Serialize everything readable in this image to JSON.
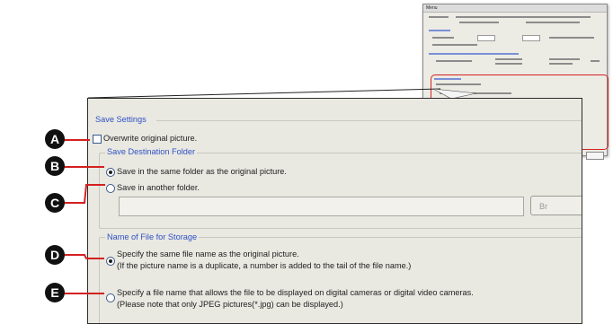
{
  "mini_dialog": {
    "title": "Menu"
  },
  "panel": {
    "save_settings": "Save Settings",
    "overwrite": "Overwrite original picture.",
    "dest_folder": "Save Destination Folder",
    "same_folder": "Save in the same folder as the original picture.",
    "another_folder": "Save in another folder.",
    "folder_path": "",
    "browse": "Br",
    "file_name_group": "Name of File for Storage",
    "same_name_line1": "Specify the same file name as the original picture.",
    "same_name_line2": "(If the picture name is a duplicate, a number is added to the tail of the file name.)",
    "camera_name_line1": "Specify a file name that allows the file to be displayed on digital cameras or digital video cameras.",
    "camera_name_line2": "(Please note that only JPEG pictures(*.jpg) can be displayed.)"
  },
  "markers": [
    "A",
    "B",
    "C",
    "D",
    "E"
  ],
  "colors": {
    "marker_line": "#d42020",
    "highlight": "#d62222",
    "group_heading": "#2f52c4"
  }
}
